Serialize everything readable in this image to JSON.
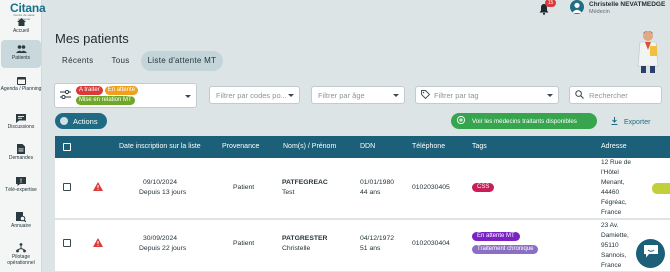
{
  "brand": {
    "name": "Citana",
    "tagline": "Centre de santé connecté"
  },
  "header": {
    "notifications_count": "15",
    "user_name": "Christelle NEVATMEDGE",
    "user_role": "Médecin"
  },
  "sidebar": {
    "items": [
      {
        "label": "Accueil",
        "icon": "home-icon"
      },
      {
        "label": "Patients",
        "icon": "patients-icon",
        "active": true
      },
      {
        "label": "Agenda / Planning",
        "icon": "calendar-icon"
      },
      {
        "label": "Discussions",
        "icon": "chat-icon"
      },
      {
        "label": "Demandes",
        "icon": "document-icon"
      },
      {
        "label": "Télé-expertise",
        "icon": "tele-expertise-icon"
      },
      {
        "label": "Annuaire",
        "icon": "directory-icon"
      },
      {
        "label": "Pilotage opérationnel",
        "icon": "pilotage-icon"
      }
    ]
  },
  "page": {
    "title": "Mes patients",
    "tabs": [
      {
        "label": "Récents",
        "active": false
      },
      {
        "label": "Tous",
        "active": false
      },
      {
        "label": "Liste d'attente MT",
        "active": true
      }
    ]
  },
  "filters": {
    "status_chips": [
      {
        "label": "A traiter",
        "color": "#d93a3a"
      },
      {
        "label": "En attente",
        "color": "#f0a01f"
      },
      {
        "label": "Mise en relation MT",
        "color": "#6fa72a"
      }
    ],
    "postal_placeholder": "Filtrer par codes po...",
    "age_placeholder": "Filtrer par âge",
    "tag_placeholder": "Filtrer par tag",
    "search_placeholder": "Rechercher"
  },
  "actions": {
    "actions_label": "Actions",
    "mt_button_label": "Voir les médecins traitants disponibles",
    "export_label": "Exporter"
  },
  "table": {
    "columns": [
      "Date inscription sur la liste",
      "Provenance",
      "Nom(s) / Prénom",
      "DDN",
      "Téléphone",
      "Tags",
      "Adresse"
    ],
    "rows": [
      {
        "date": "09/10/2024",
        "since": "Depuis 13 jours",
        "provenance": "Patient",
        "last_name": "PATFEGREAC",
        "first_name": "Test",
        "ddn": "01/01/1980",
        "age": "44 ans",
        "phone": "0102030405",
        "tags": [
          {
            "label": "CSS",
            "color": "#c81e5a"
          }
        ],
        "address": [
          "12 Rue de",
          "l'Hôtel",
          "Menant,",
          "44460",
          "Fégréac,",
          "France"
        ]
      },
      {
        "date": "30/09/2024",
        "since": "Depuis 22 jours",
        "provenance": "Patient",
        "last_name": "PATGRESTER",
        "first_name": "Christelle",
        "ddn": "04/12/1972",
        "age": "51 ans",
        "phone": "0102030404",
        "tags": [
          {
            "label": "En attente MT",
            "color": "#7b22c4"
          },
          {
            "label": "Traitement chronique",
            "color": "#8b6fc4"
          }
        ],
        "address": [
          "23 Av.",
          "Damiette,",
          "95110",
          "Sannois,",
          "France"
        ]
      }
    ]
  }
}
